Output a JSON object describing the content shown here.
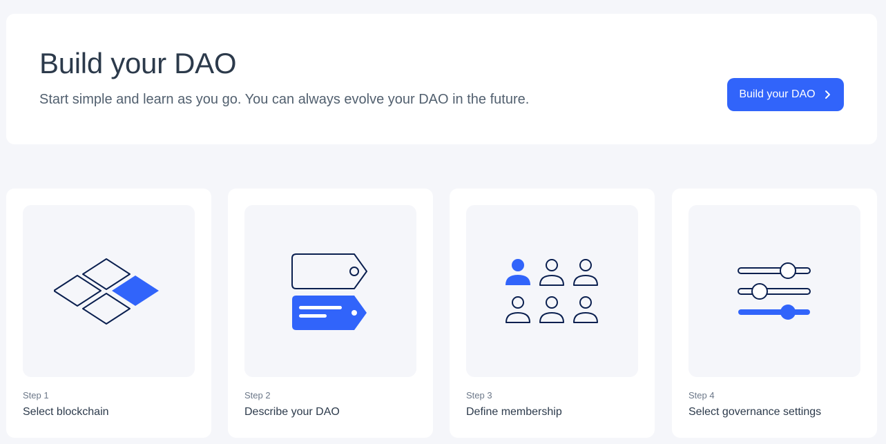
{
  "hero": {
    "title": "Build your DAO",
    "subtitle": "Start simple and learn as you go. You can always evolve your DAO in the future.",
    "button_label": "Build your DAO"
  },
  "steps": [
    {
      "step": "Step 1",
      "label": "Select blockchain",
      "icon": "blockchain-icon"
    },
    {
      "step": "Step 2",
      "label": "Describe your DAO",
      "icon": "tags-icon"
    },
    {
      "step": "Step 3",
      "label": "Define membership",
      "icon": "members-icon"
    },
    {
      "step": "Step 4",
      "label": "Select governance settings",
      "icon": "sliders-icon"
    }
  ],
  "colors": {
    "accent": "#3164fa",
    "stroke": "#0a1f4f",
    "card_bg": "#ffffff",
    "page_bg": "#f5f6fa"
  }
}
